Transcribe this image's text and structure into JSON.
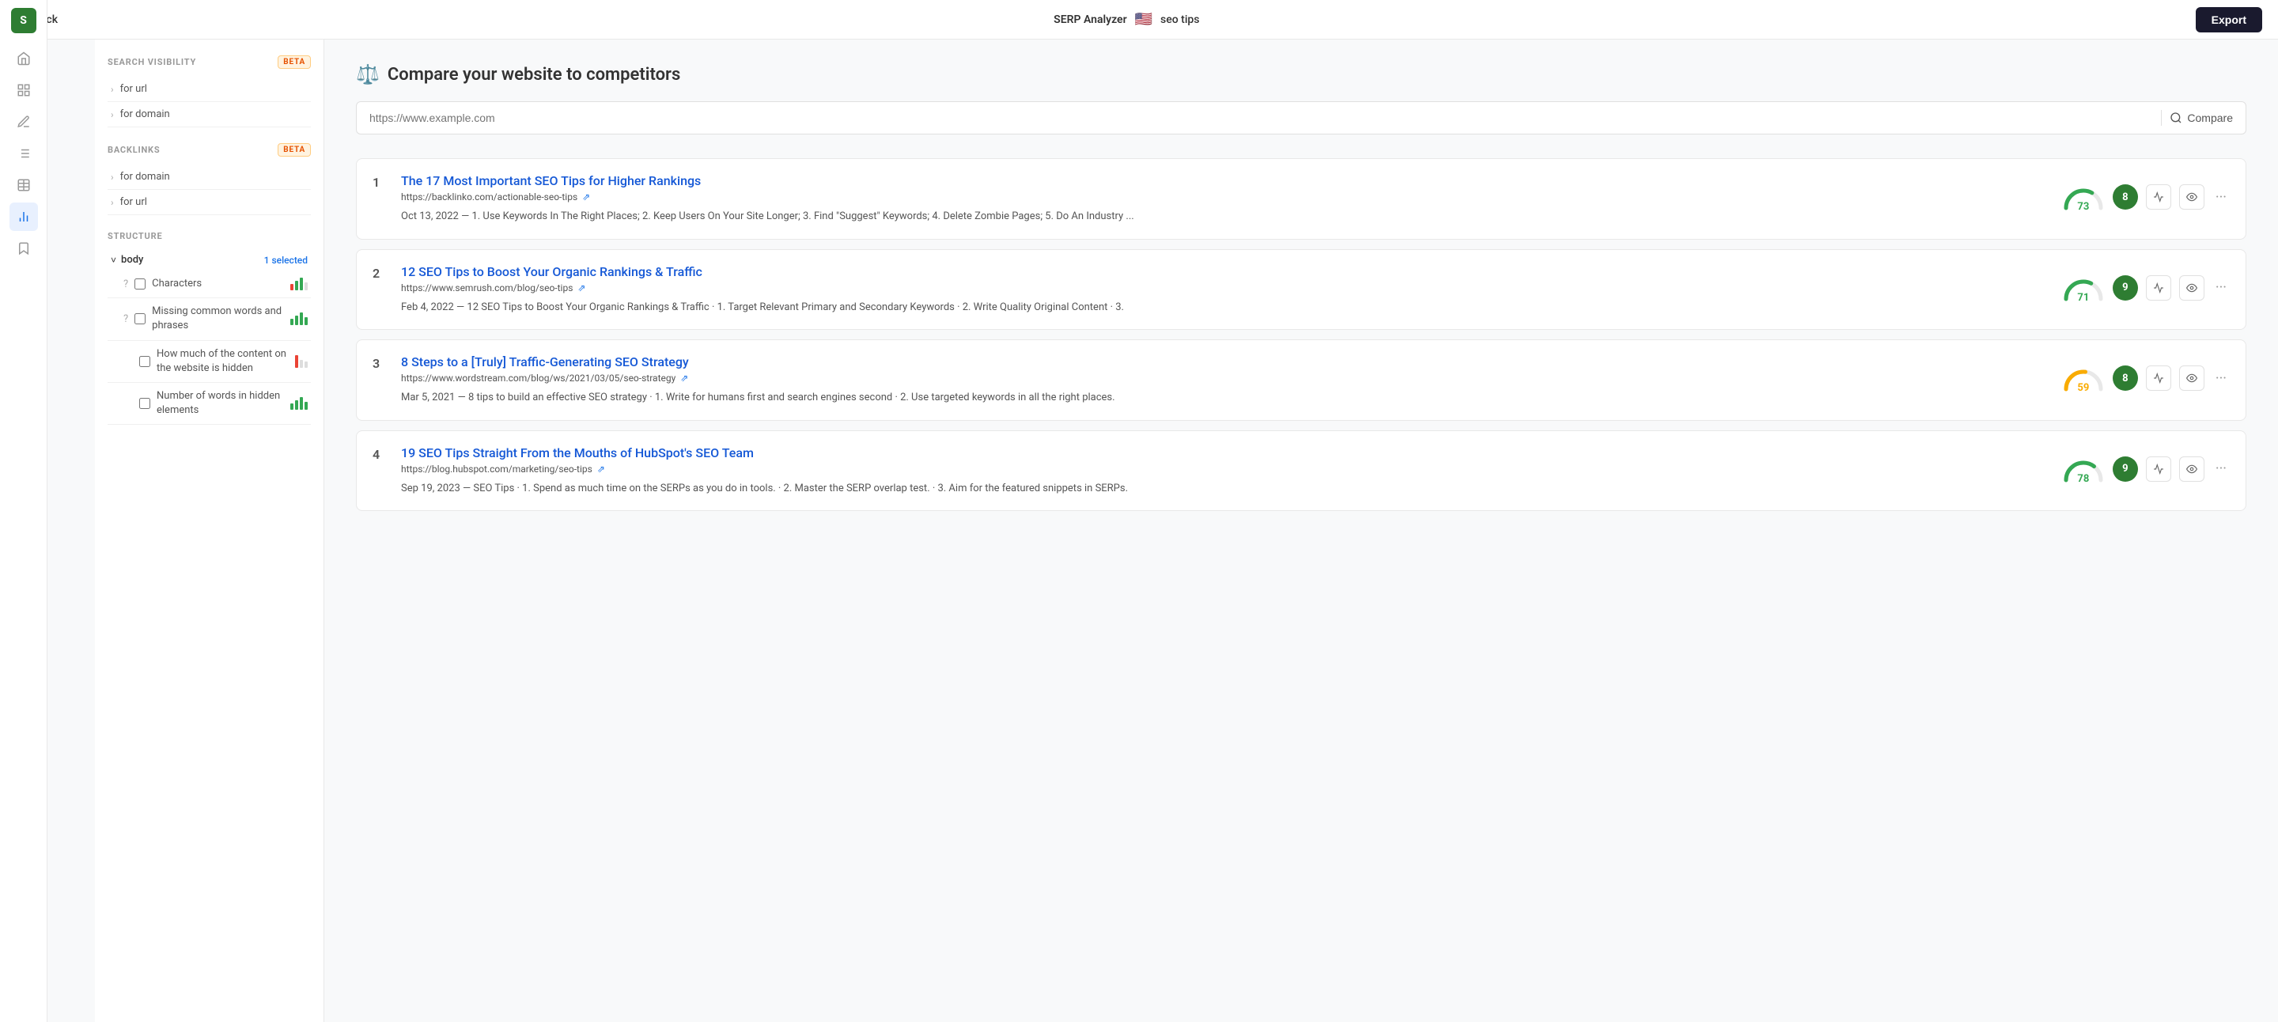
{
  "header": {
    "back_label": "Back",
    "tool_name": "SERP Analyzer",
    "keyword": "seo tips",
    "export_label": "Export"
  },
  "sidebar": {
    "search_visibility_label": "SEARCH VISIBILITY",
    "backlinks_label": "BACKLINKS",
    "structure_label": "STRUCTURE",
    "beta_label": "BETA",
    "search_visibility_items": [
      {
        "label": "for url"
      },
      {
        "label": "for domain"
      }
    ],
    "backlinks_items": [
      {
        "label": "for domain"
      },
      {
        "label": "for url"
      }
    ],
    "body_label": "body",
    "selected_text": "1 selected",
    "structure_items": [
      {
        "id": "characters",
        "label": "Characters",
        "bars": "mixed",
        "has_help": true,
        "checked": false
      },
      {
        "id": "missing-words",
        "label": "Missing common words and phrases",
        "bars": "green",
        "has_help": true,
        "checked": false
      },
      {
        "id": "hidden-content",
        "label": "How much of the content on the website is hidden",
        "bars": "red",
        "has_help": false,
        "checked": false
      },
      {
        "id": "hidden-words",
        "label": "Number of words in hidden elements",
        "bars": "green",
        "has_help": false,
        "checked": false
      }
    ]
  },
  "compare": {
    "title": "Compare your website to competitors",
    "placeholder": "https://www.example.com",
    "button_label": "Compare",
    "icon": "⚖️"
  },
  "results": [
    {
      "rank": 1,
      "title": "The 17 Most Important SEO Tips for Higher Rankings",
      "url": "https://backlinko.com/actionable-seo-tips",
      "snippet": "Oct 13, 2022 — 1. Use Keywords In The Right Places; 2. Keep Users On Your Site Longer; 3. Find \"Suggest\" Keywords; 4. Delete Zombie Pages; 5. Do An Industry ...",
      "score": 73,
      "score_color": "#34a853",
      "authority": 8,
      "authority_color": "#2e7d32"
    },
    {
      "rank": 2,
      "title": "12 SEO Tips to Boost Your Organic Rankings & Traffic",
      "url": "https://www.semrush.com/blog/seo-tips",
      "snippet": "Feb 4, 2022 — 12 SEO Tips to Boost Your Organic Rankings & Traffic · 1. Target Relevant Primary and Secondary Keywords · 2. Write Quality Original Content · 3.",
      "score": 71,
      "score_color": "#34a853",
      "authority": 9,
      "authority_color": "#2e7d32"
    },
    {
      "rank": 3,
      "title": "8 Steps to a [Truly] Traffic-Generating SEO Strategy",
      "url": "https://www.wordstream.com/blog/ws/2021/03/05/seo-strategy",
      "snippet": "Mar 5, 2021 — 8 tips to build an effective SEO strategy · 1. Write for humans first and search engines second · 2. Use targeted keywords in all the right places.",
      "score": 59,
      "score_color": "#f9ab00",
      "authority": 8,
      "authority_color": "#2e7d32"
    },
    {
      "rank": 4,
      "title": "19 SEO Tips Straight From the Mouths of HubSpot's SEO Team",
      "url": "https://blog.hubspot.com/marketing/seo-tips",
      "snippet": "Sep 19, 2023 — SEO Tips · 1. Spend as much time on the SERPs as you do in tools. · 2. Master the SERP overlap test. · 3. Aim for the featured snippets in SERPs.",
      "score": 78,
      "score_color": "#34a853",
      "authority": 9,
      "authority_color": "#2e7d32"
    }
  ],
  "icons": {
    "home": "🏠",
    "grid": "⊞",
    "edit": "✏️",
    "list": "☰",
    "table": "▦",
    "bar_chart": "📊",
    "bookmark": "🔖",
    "search": "🔍",
    "chart": "📈",
    "eye": "👁",
    "more": "•••"
  }
}
